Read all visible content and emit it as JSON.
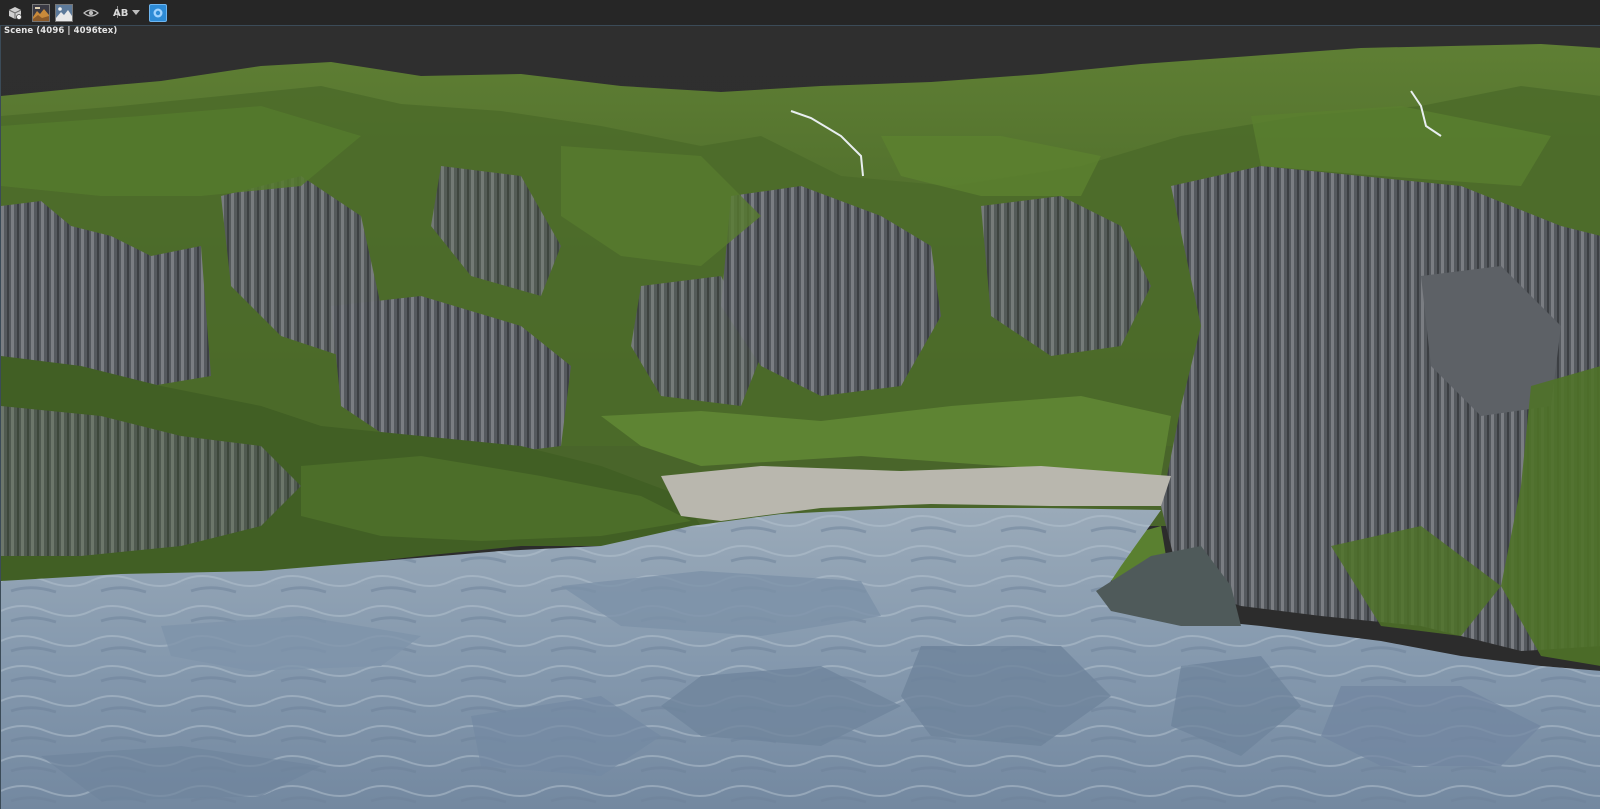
{
  "toolbar": {
    "buttons": [
      {
        "name": "camera-tool-icon"
      },
      {
        "name": "terrain-preview-icon"
      },
      {
        "name": "image-preview-icon"
      },
      {
        "name": "visibility-eye-icon"
      },
      {
        "name": "ab-compare-icon"
      },
      {
        "name": "render-mode-icon"
      }
    ],
    "ab_label": "AB",
    "accent_color": "#2d8bd6"
  },
  "viewport": {
    "scene_label": "Scene (4096 | 4096tex)"
  },
  "colors": {
    "background": "#2d2d2d",
    "grass": "#4f6b2a",
    "rock": "#5b5f63",
    "water": "#8ea4b8",
    "sand": "#b8b6ae"
  }
}
